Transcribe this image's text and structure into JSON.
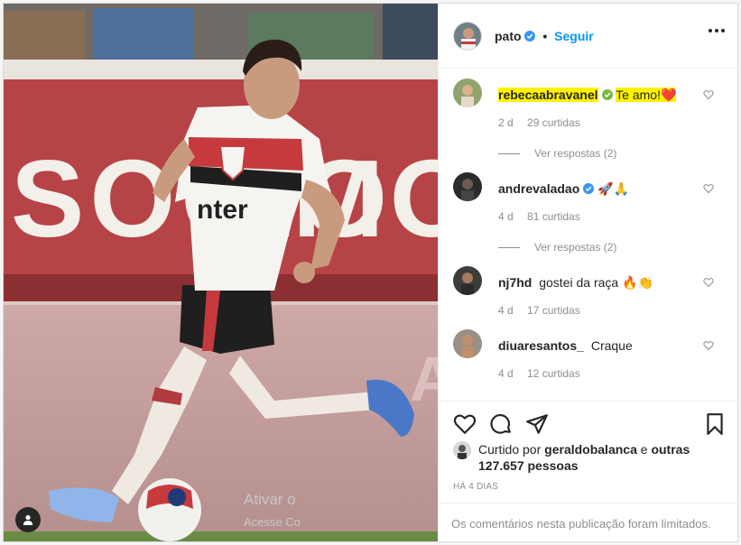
{
  "post": {
    "author": "pato",
    "follow_label": "Seguir",
    "more_icon": "more-options-icon"
  },
  "comments": [
    {
      "user": "rebecaabravanel",
      "text": "Te amo!",
      "emoji": "❤️",
      "age": "2 d",
      "likes": "29 curtidas",
      "replies": "Ver respostas (2)",
      "verified": true
    },
    {
      "user": "andrevaladao",
      "text": "",
      "emoji": "🚀🙏",
      "age": "4 d",
      "likes": "81 curtidas",
      "replies": "Ver respostas (2)",
      "verified": true
    },
    {
      "user": "nj7hd",
      "text": "gostei da raça",
      "emoji": "🔥👏",
      "age": "4 d",
      "likes": "17 curtidas",
      "verified": false
    },
    {
      "user": "diuaresantos_",
      "text": "Craque",
      "emoji": "",
      "age": "4 d",
      "likes": "12 curtidas",
      "verified": false
    }
  ],
  "likes": {
    "prefix": "Curtido por",
    "user": "geraldobalanca",
    "conjunction": "e",
    "others": "outras 127.657 pessoas"
  },
  "time_ago": "HÁ 4 DIAS",
  "comments_disabled": "Os comentários nesta publicação foram limitados.",
  "watermark": {
    "line1": "Ativar o",
    "line2": "Acesse Co"
  },
  "colors": {
    "link": "#0095f6",
    "highlight": "#fff200",
    "muted": "#8e8e8e"
  }
}
